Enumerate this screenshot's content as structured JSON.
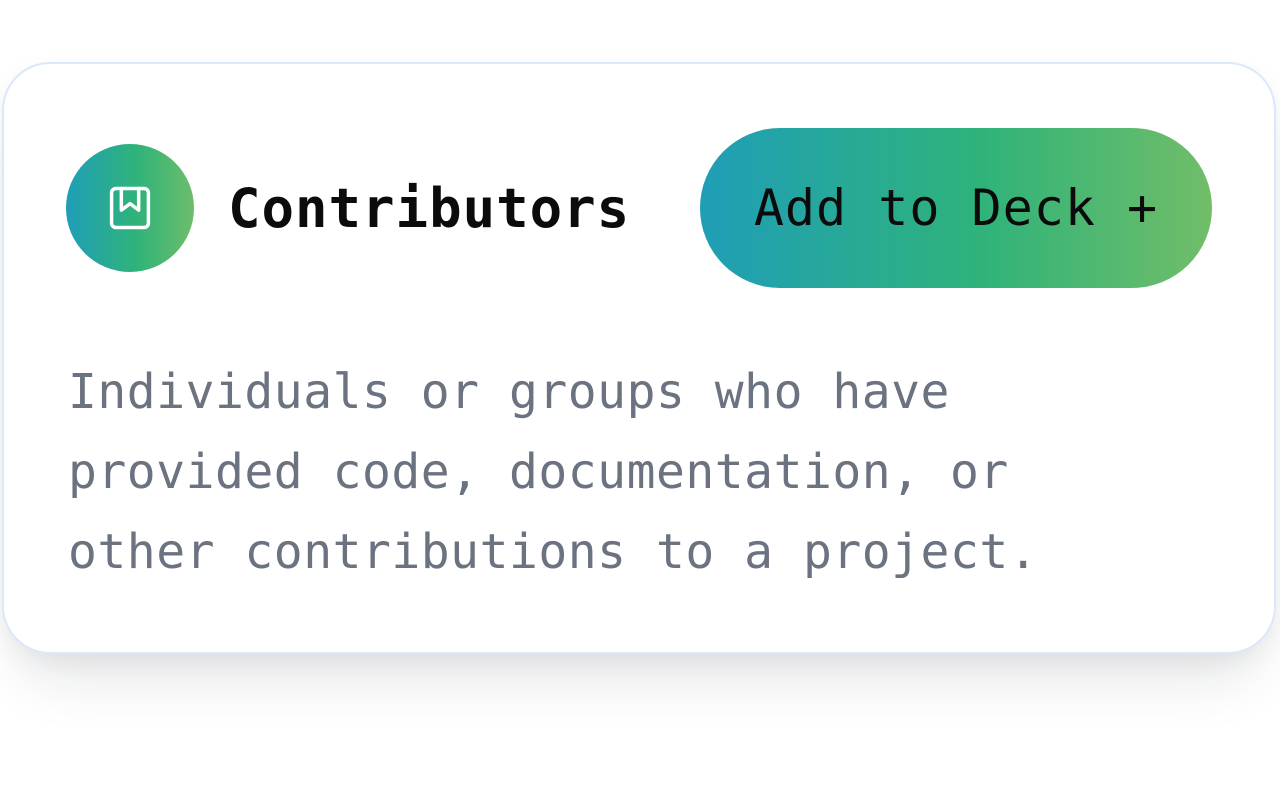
{
  "card": {
    "title": "Contributors",
    "add_button_label": "Add to Deck +",
    "description": "Individuals or groups who have provided code, documentation, or other contributions to a project.",
    "avatar_icon": "bookmark-book-icon"
  },
  "colors": {
    "gradient_start": "#1f9eb6",
    "gradient_mid": "#2fb37a",
    "gradient_end": "#71bd68",
    "title_text": "#0b0b0b",
    "description_text": "#6b7280",
    "card_border": "#dbe8fb"
  }
}
